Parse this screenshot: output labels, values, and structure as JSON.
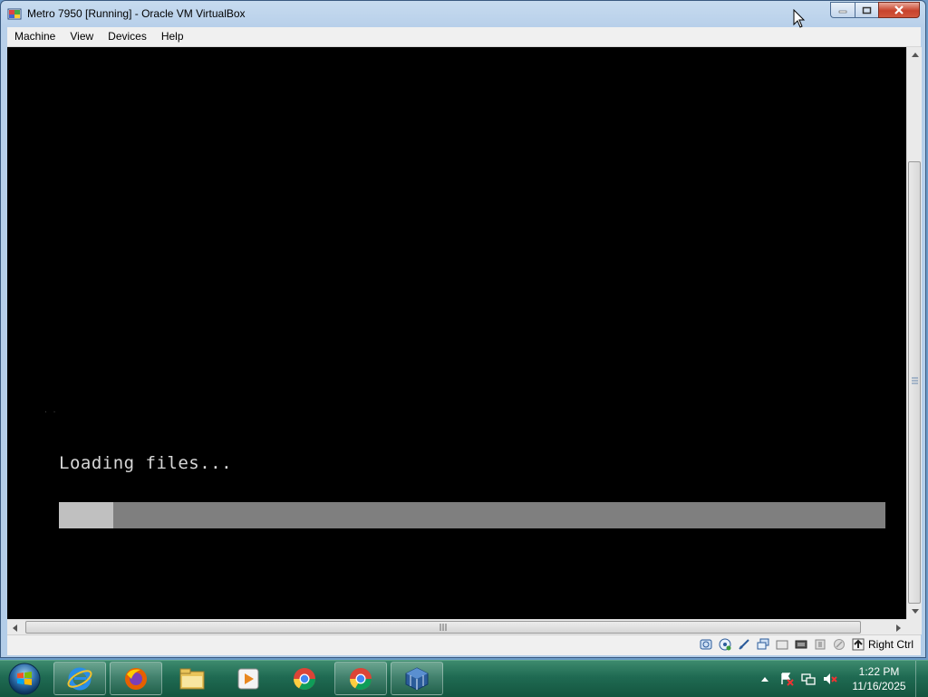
{
  "window": {
    "title": "Metro 7950 [Running] - Oracle VM VirtualBox"
  },
  "menubar": {
    "items": [
      {
        "label": "Machine"
      },
      {
        "label": "View"
      },
      {
        "label": "Devices"
      },
      {
        "label": "Help"
      }
    ]
  },
  "vm": {
    "loading_text": "Loading files...",
    "progress_fraction": 0.066,
    "faint_text": ". ."
  },
  "statusbar": {
    "host_key_label": "Right Ctrl",
    "icons": [
      "hard-disk-icon",
      "optical-drive-icon",
      "usb-icon",
      "network-icon",
      "shared-folders-icon",
      "display-icon",
      "video-capture-icon",
      "cpu-icon",
      "mouse-integration-icon",
      "host-key-icon"
    ]
  },
  "taskbar": {
    "pinned": [
      "internet-explorer-icon",
      "firefox-icon",
      "file-explorer-icon",
      "media-player-icon",
      "chrome-icon",
      "chrome-icon",
      "virtualbox-icon"
    ],
    "clock_time": "1:22 PM",
    "clock_date": "11/16/2025"
  },
  "colors": {
    "vm_background": "#000000",
    "progress_track": "#7f7f7f",
    "progress_fill": "#c0c0c0",
    "loading_text": "#d8d8d8"
  }
}
